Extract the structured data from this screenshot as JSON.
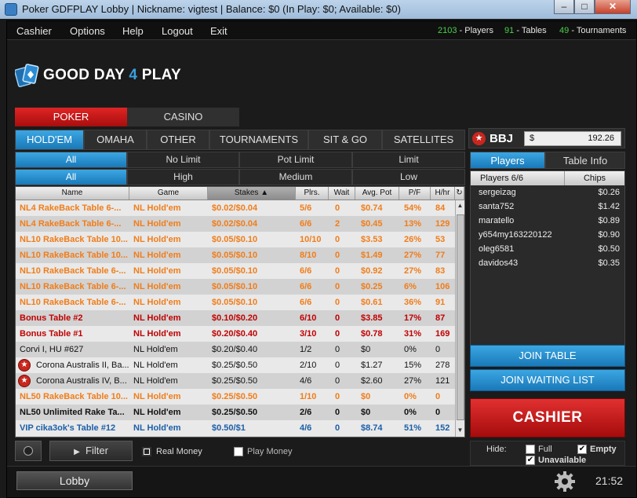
{
  "window": {
    "title": "Poker GDFPLAY Lobby | Nickname: vigtest | Balance: $0 (In Play: $0; Available: $0)",
    "min": "–",
    "max": "□",
    "close": "✕"
  },
  "menu": {
    "items": [
      "Cashier",
      "Options",
      "Help",
      "Logout",
      "Exit"
    ]
  },
  "stats": {
    "players_n": "2103",
    "players_l": "- Players",
    "tables_n": "91",
    "tables_l": "- Tables",
    "tournaments_n": "49",
    "tournaments_l": "- Tournaments"
  },
  "logo": {
    "text_a": "GOOD DAY ",
    "text_b": "4",
    "text_c": " PLAY"
  },
  "main_tabs": [
    "POKER",
    "CASINO"
  ],
  "game_tabs": [
    "HOLD'EM",
    "OMAHA",
    "OTHER",
    "TOURNAMENTS",
    "SIT & GO",
    "SATELLITES"
  ],
  "limit_filters": [
    "All",
    "No Limit",
    "Pot Limit",
    "Limit"
  ],
  "stake_filters": [
    "All",
    "High",
    "Medium",
    "Low"
  ],
  "columns": [
    "Name",
    "Game",
    "Stakes",
    "Plrs.",
    "Wait",
    "Avg. Pot",
    "P/F",
    "H/hr"
  ],
  "rows": [
    {
      "style": "orange",
      "star": false,
      "cells": [
        "NL4 RakeBack Table 6-...",
        "NL Hold'em",
        "$0.02/$0.04",
        "5/6",
        "0",
        "$0.74",
        "54%",
        "84"
      ]
    },
    {
      "style": "orange",
      "star": false,
      "cells": [
        "NL4 RakeBack Table 6-...",
        "NL Hold'em",
        "$0.02/$0.04",
        "6/6",
        "2",
        "$0.45",
        "13%",
        "129"
      ]
    },
    {
      "style": "orange",
      "star": false,
      "cells": [
        "NL10 RakeBack Table 10...",
        "NL Hold'em",
        "$0.05/$0.10",
        "10/10",
        "0",
        "$3.53",
        "26%",
        "53"
      ]
    },
    {
      "style": "orange",
      "star": false,
      "cells": [
        "NL10 RakeBack Table 10...",
        "NL Hold'em",
        "$0.05/$0.10",
        "8/10",
        "0",
        "$1.49",
        "27%",
        "77"
      ]
    },
    {
      "style": "orange",
      "star": false,
      "cells": [
        "NL10 RakeBack Table 6-...",
        "NL Hold'em",
        "$0.05/$0.10",
        "6/6",
        "0",
        "$0.92",
        "27%",
        "83"
      ]
    },
    {
      "style": "orange",
      "star": false,
      "cells": [
        "NL10 RakeBack Table 6-...",
        "NL Hold'em",
        "$0.05/$0.10",
        "6/6",
        "0",
        "$0.25",
        "6%",
        "106"
      ]
    },
    {
      "style": "orange",
      "star": false,
      "cells": [
        "NL10 RakeBack Table 6-...",
        "NL Hold'em",
        "$0.05/$0.10",
        "6/6",
        "0",
        "$0.61",
        "36%",
        "91"
      ]
    },
    {
      "style": "red",
      "star": false,
      "cells": [
        "Bonus Table  #2",
        "NL Hold'em",
        "$0.10/$0.20",
        "6/10",
        "0",
        "$3.85",
        "17%",
        "87"
      ]
    },
    {
      "style": "red",
      "star": false,
      "cells": [
        "Bonus Table      #1",
        "NL Hold'em",
        "$0.20/$0.40",
        "3/10",
        "0",
        "$0.78",
        "31%",
        "169"
      ]
    },
    {
      "style": "black",
      "star": false,
      "cells": [
        "Corvi I, HU #627",
        "NL Hold'em",
        "$0.20/$0.40",
        "1/2",
        "0",
        "$0",
        "0%",
        "0"
      ]
    },
    {
      "style": "black",
      "star": true,
      "cells": [
        "Corona Australis II, Ba...",
        "NL Hold'em",
        "$0.25/$0.50",
        "2/10",
        "0",
        "$1.27",
        "15%",
        "278"
      ]
    },
    {
      "style": "black",
      "star": true,
      "cells": [
        "Corona Australis IV, B...",
        "NL Hold'em",
        "$0.25/$0.50",
        "4/6",
        "0",
        "$2.60",
        "27%",
        "121"
      ]
    },
    {
      "style": "orange",
      "star": false,
      "cells": [
        "NL50 RakeBack Table 10...",
        "NL Hold'em",
        "$0.25/$0.50",
        "1/10",
        "0",
        "$0",
        "0%",
        "0"
      ]
    },
    {
      "style": "blackbold",
      "star": false,
      "cells": [
        "NL50 Unlimited Rake Ta...",
        "NL Hold'em",
        "$0.25/$0.50",
        "2/6",
        "0",
        "$0",
        "0%",
        "0"
      ]
    },
    {
      "style": "blue",
      "star": false,
      "cells": [
        "VIP cika3ok's Table #12",
        "NL Hold'em",
        "$0.50/$1",
        "4/6",
        "0",
        "$8.74",
        "51%",
        "152"
      ]
    }
  ],
  "bottom": {
    "filter": "Filter",
    "real_money": "Real Money",
    "play_money": "Play Money"
  },
  "bbj": {
    "label": "BBJ",
    "currency": "$",
    "amount": "192.26"
  },
  "panel_tabs": [
    "Players",
    "Table Info"
  ],
  "players": {
    "col_players": "Players 6/6",
    "col_chips": "Chips",
    "list": [
      {
        "name": "sergeizag",
        "chips": "$0.26"
      },
      {
        "name": "santa752",
        "chips": "$1.42"
      },
      {
        "name": "maratello",
        "chips": "$0.89"
      },
      {
        "name": "y654my163220122",
        "chips": "$0.90"
      },
      {
        "name": "oleg6581",
        "chips": "$0.50"
      },
      {
        "name": "davidos43",
        "chips": "$0.35"
      }
    ]
  },
  "join_table": "JOIN TABLE",
  "join_waiting": "JOIN WAITING LIST",
  "cashier_btn": "CASHIER",
  "hide": {
    "label": "Hide:",
    "full": "Full",
    "empty": "Empty",
    "unavailable": "Unavailable"
  },
  "footer": {
    "lobby": "Lobby",
    "clock": "21:52"
  },
  "colors": {
    "accent_blue": "#1a79b8",
    "accent_red": "#c8261e",
    "stat_green": "#4bd04b",
    "row_orange": "#f07d1a"
  }
}
